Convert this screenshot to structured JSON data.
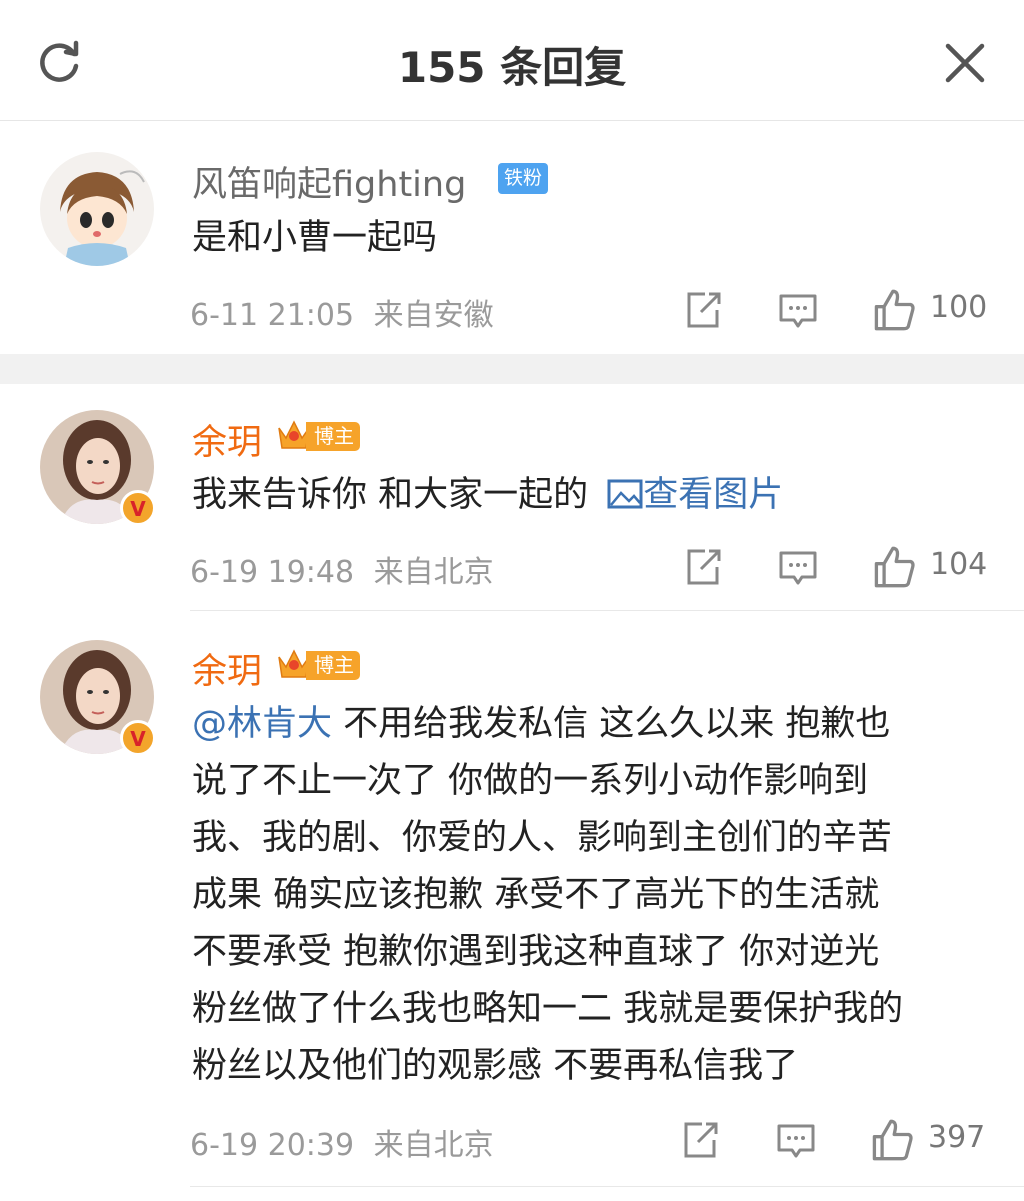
{
  "header": {
    "title": "155 条回复",
    "refresh_icon": "refresh-icon",
    "close_icon": "close-icon"
  },
  "comments": [
    {
      "username": "风笛响起fighting",
      "badge": "铁粉",
      "text": "是和小曹一起吗",
      "time": "6-11 21:05",
      "location": "来自安徽",
      "likes": "100"
    },
    {
      "username": "余玥",
      "badge": "博主",
      "text": "我来告诉你 和大家一起的",
      "link": "查看图片",
      "time": "6-19 19:48",
      "location": "来自北京",
      "likes": "104"
    },
    {
      "username": "余玥",
      "badge": "博主",
      "mention": "@林肯大",
      "text_lines": [
        " 不用给我发私信 这么久以来 抱歉也",
        "说了不止一次了 你做的一系列小动作影响到",
        "我、我的剧、你爱的人、影响到主创们的辛苦",
        "成果 确实应该抱歉 承受不了高光下的生活就",
        "不要承受 抱歉你遇到我这种直球了 你对逆光",
        "粉丝做了什么我也略知一二 我就是要保护我的",
        "粉丝以及他们的观影感 不要再私信我了"
      ],
      "time": "6-19 20:39",
      "location": "来自北京",
      "likes": "397"
    }
  ],
  "colors": {
    "orange_name": "#f06a11",
    "link_blue": "#3b72b3",
    "fan_badge": "#4ea3f0",
    "blogger_badge": "#f6a32a"
  }
}
